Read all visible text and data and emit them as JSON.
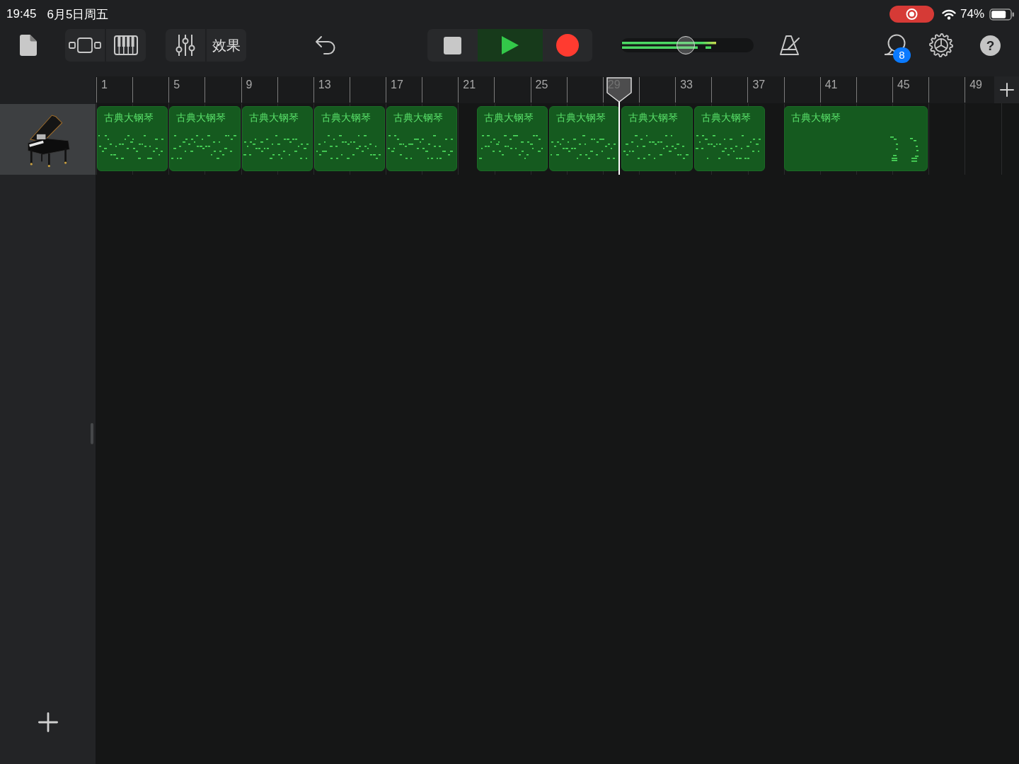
{
  "status_bar": {
    "time": "19:45",
    "date": "6月5日周五",
    "battery": "74%"
  },
  "toolbar": {
    "effects_button": "效果",
    "transport": [
      {
        "kind": "stop",
        "active": false
      },
      {
        "kind": "play",
        "active": true
      },
      {
        "kind": "record",
        "active": false
      }
    ],
    "volume": {
      "level": 0.49
    },
    "loop_badge": "8",
    "help_button": "?"
  },
  "ruler": {
    "bar_numbers": [
      "1",
      "5",
      "9",
      "13",
      "17",
      "21",
      "25",
      "29",
      "33",
      "37",
      "41",
      "45",
      "49"
    ],
    "playhead": {
      "level": 0.583
    }
  },
  "tracks": [
    {
      "selected": true,
      "regions": [
        {
          "title": "古典大钢琴"
        },
        {
          "title": "古典大钢琴"
        },
        {
          "title": "古典大钢琴"
        },
        {
          "title": "古典大钢琴"
        },
        {
          "title": "古典大钢琴"
        },
        {
          "title": "古典大钢琴"
        },
        {
          "title": "古典大钢琴"
        },
        {
          "title": "古典大钢琴"
        },
        {
          "title": "古典大钢琴"
        },
        {
          "title": "古典大钢琴"
        }
      ]
    }
  ]
}
